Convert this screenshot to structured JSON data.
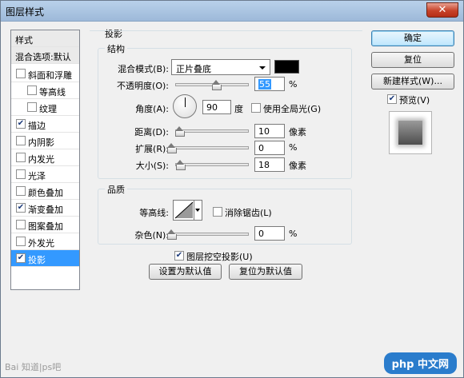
{
  "window": {
    "title": "图层样式",
    "close_glyph": "✕"
  },
  "sidebar": {
    "items": [
      {
        "label": "样式",
        "type": "header"
      },
      {
        "label": "混合选项:默认",
        "type": "header"
      },
      {
        "label": "斜面和浮雕",
        "checked": false,
        "indent": false
      },
      {
        "label": "等高线",
        "checked": false,
        "indent": true
      },
      {
        "label": "纹理",
        "checked": false,
        "indent": true
      },
      {
        "label": "描边",
        "checked": true,
        "indent": false
      },
      {
        "label": "内阴影",
        "checked": false,
        "indent": false
      },
      {
        "label": "内发光",
        "checked": false,
        "indent": false
      },
      {
        "label": "光泽",
        "checked": false,
        "indent": false
      },
      {
        "label": "颜色叠加",
        "checked": false,
        "indent": false
      },
      {
        "label": "渐变叠加",
        "checked": true,
        "indent": false
      },
      {
        "label": "图案叠加",
        "checked": false,
        "indent": false
      },
      {
        "label": "外发光",
        "checked": false,
        "indent": false
      },
      {
        "label": "投影",
        "checked": true,
        "indent": false,
        "selected": true
      }
    ]
  },
  "panel": {
    "title": "投影",
    "structure": {
      "title": "结构",
      "blend_mode_label": "混合模式(B):",
      "blend_mode_value": "正片叠底",
      "blend_color": "#000000",
      "opacity_label": "不透明度(O):",
      "opacity_value": "55",
      "opacity_unit": "%",
      "opacity_fraction": 0.55,
      "angle_label": "角度(A):",
      "angle_value": "90",
      "angle_unit": "度",
      "global_light_label": "使用全局光(G)",
      "global_light_checked": false,
      "distance_label": "距离(D):",
      "distance_value": "10",
      "distance_unit": "像素",
      "distance_fraction": 0.05,
      "spread_label": "扩展(R):",
      "spread_value": "0",
      "spread_unit": "%",
      "spread_fraction": 0.0,
      "size_label": "大小(S):",
      "size_value": "18",
      "size_unit": "像素",
      "size_fraction": 0.07
    },
    "quality": {
      "title": "品质",
      "contour_label": "等高线:",
      "anti_alias_label": "消除锯齿(L)",
      "anti_alias_checked": false,
      "noise_label": "杂色(N):",
      "noise_value": "0",
      "noise_unit": "%",
      "noise_fraction": 0.0
    },
    "knockout_label": "图层挖空投影(U)",
    "knockout_checked": true,
    "set_default_label": "设置为默认值",
    "reset_default_label": "复位为默认值"
  },
  "buttons": {
    "ok": "确定",
    "reset": "复位",
    "new_style": "新建样式(W)...",
    "preview_label": "预览(V)",
    "preview_checked": true
  },
  "watermarks": {
    "baidu": "Bai 知道|ps吧",
    "php": "php 中文网"
  }
}
